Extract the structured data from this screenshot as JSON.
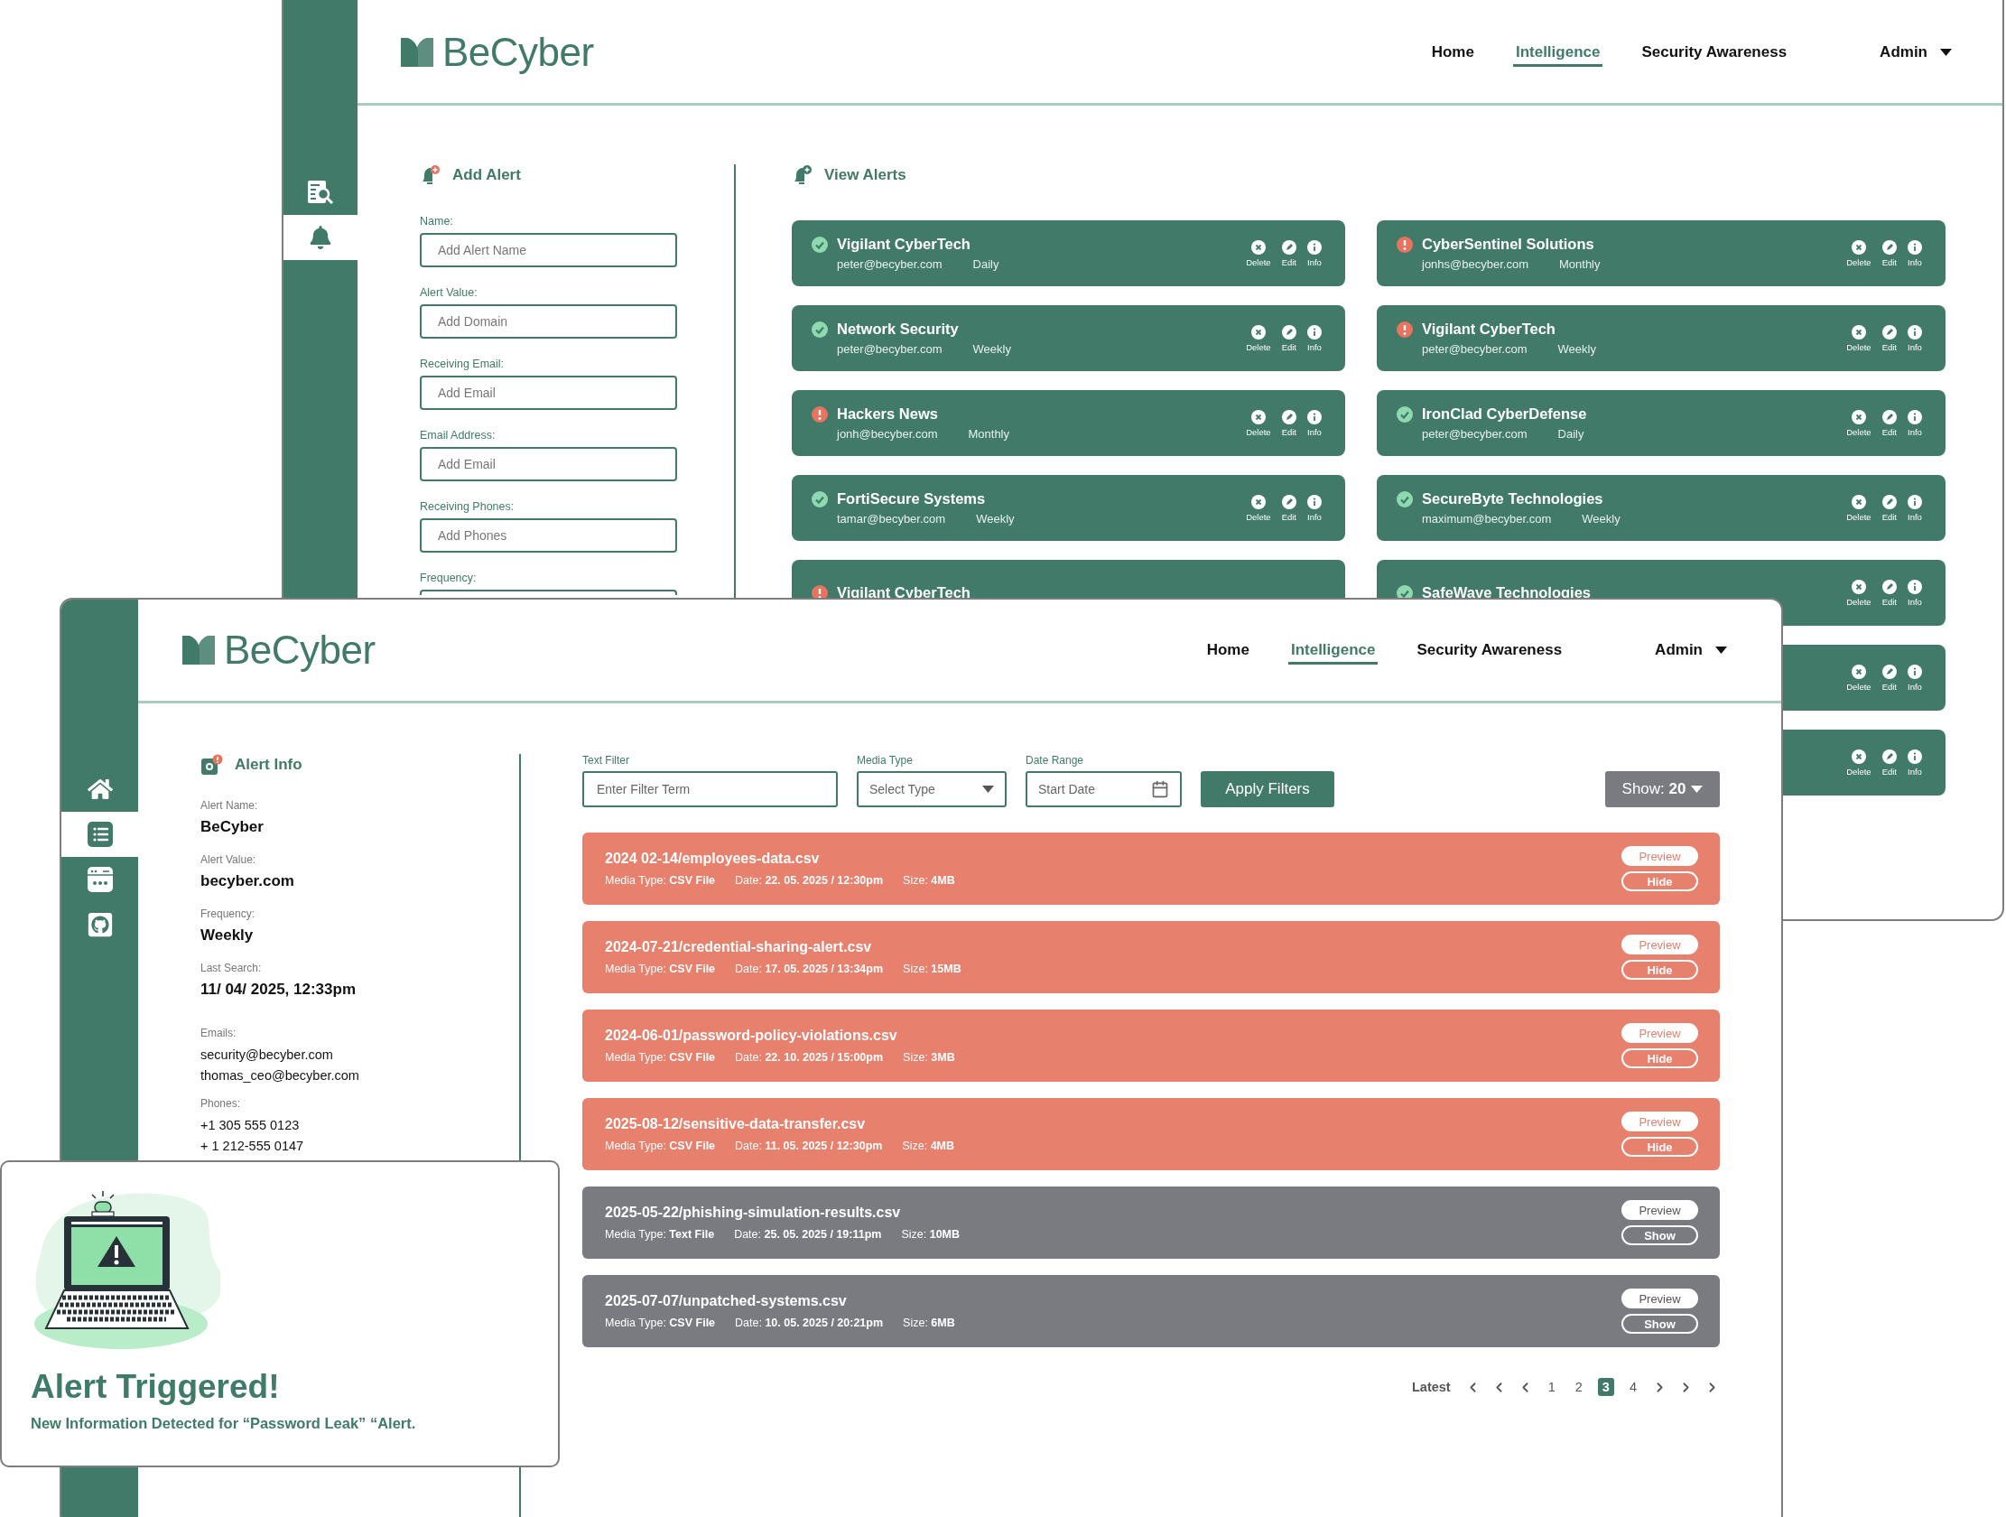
{
  "back_window": {
    "logo": "BeCyber",
    "nav": [
      {
        "label": "Home",
        "selected": false
      },
      {
        "label": "Intelligence",
        "selected": true
      },
      {
        "label": "Security Awareness",
        "selected": false
      }
    ],
    "admin": "Admin",
    "sidebar": [
      {
        "kind": "search",
        "selected": false
      },
      {
        "kind": "bell",
        "selected": true
      }
    ],
    "add_alert": {
      "title": "Add Alert",
      "fields": [
        {
          "label": "Name:",
          "placeholder": "Add Alert Name"
        },
        {
          "label": "Alert Value:",
          "placeholder": "Add Domain"
        },
        {
          "label": "Receiving Email:",
          "placeholder": "Add Email"
        },
        {
          "label": "Email Address:",
          "placeholder": "Add Email"
        },
        {
          "label": "Receiving Phones:",
          "placeholder": "Add Phones"
        },
        {
          "label": "Frequency:"
        }
      ]
    },
    "view_alerts": {
      "title": "View Alerts",
      "columns": [
        {
          "cards": [
            {
              "name": "Vigilant CyberTech",
              "email": "peter@becyber.com",
              "frequency": "Daily",
              "warning": false,
              "actions": [
                "Delete",
                "Edit",
                "Info"
              ]
            },
            {
              "name": "Network Security",
              "email": "peter@becyber.com",
              "frequency": "Weekly",
              "warning": false,
              "actions": [
                "Delete",
                "Edit",
                "Info"
              ]
            },
            {
              "name": "Hackers News",
              "email": "jonh@becyber.com",
              "frequency": "Monthly",
              "warning": true,
              "actions": [
                "Delete",
                "Edit",
                "Info"
              ]
            },
            {
              "name": "FortiSecure Systems",
              "email": "tamar@becyber.com",
              "frequency": "Weekly",
              "warning": false,
              "actions": [
                "Delete",
                "Edit",
                "Info"
              ]
            },
            {
              "name": "Vigilant CyberTech",
              "warning": true
            }
          ]
        },
        {
          "cards": [
            {
              "name": "CyberSentinel Solutions",
              "email": "jonhs@becyber.com",
              "frequency": "Monthly",
              "warning": true,
              "actions": [
                "Delete",
                "Edit",
                "Info"
              ]
            },
            {
              "name": "Vigilant CyberTech",
              "email": "peter@becyber.com",
              "frequency": "Weekly",
              "warning": true,
              "actions": [
                "Delete",
                "Edit",
                "Info"
              ]
            },
            {
              "name": "IronClad CyberDefense",
              "email": "peter@becyber.com",
              "frequency": "Daily",
              "warning": false,
              "actions": [
                "Delete",
                "Edit",
                "Info"
              ]
            },
            {
              "name": "SecureByte Technologies",
              "email": "maximum@becyber.com",
              "frequency": "Weekly",
              "warning": false,
              "actions": [
                "Delete",
                "Edit",
                "Info"
              ]
            },
            {
              "name": "SafeWave Technologies",
              "warning": false,
              "actions": [
                "Delete",
                "Edit",
                "Info"
              ]
            },
            {
              "actions": [
                "Delete",
                "Edit",
                "Info"
              ]
            },
            {
              "actions": [
                "Delete",
                "Edit",
                "Info"
              ]
            }
          ]
        }
      ]
    }
  },
  "front_window": {
    "logo": "BeCyber",
    "nav": [
      {
        "label": "Home",
        "selected": false
      },
      {
        "label": "Intelligence",
        "selected": true
      },
      {
        "label": "Security Awareness",
        "selected": false
      }
    ],
    "admin": "Admin",
    "sidebar": [
      {
        "kind": "home",
        "selected": false
      },
      {
        "kind": "list",
        "selected": true
      },
      {
        "kind": "password",
        "selected": false
      },
      {
        "kind": "github",
        "selected": false
      }
    ],
    "alert_info": {
      "title": "Alert Info",
      "fields": [
        {
          "kind": "summary",
          "label": "Alert Name:",
          "values": [
            "BeCyber"
          ]
        },
        {
          "kind": "summary",
          "label": "Alert Value:",
          "values": [
            "becyber.com"
          ]
        },
        {
          "kind": "summary",
          "label": "Frequency:",
          "values": [
            "Weekly"
          ]
        },
        {
          "kind": "summary",
          "label": "Last Search:",
          "values": [
            "11/ 04/ 2025, 12:33pm"
          ]
        },
        {
          "kind": "list",
          "label": "Emails:",
          "values": [
            "security@becyber.com",
            "thomas_ceo@becyber.com"
          ]
        },
        {
          "kind": "list",
          "label": "Phones:",
          "values": [
            "+1 305 555 0123",
            "+ 1 212-555 0147"
          ]
        }
      ]
    },
    "filters": {
      "text_filter": {
        "label": "Text Filter",
        "placeholder": "Enter Filter Term"
      },
      "media_type": {
        "label": "Media Type",
        "placeholder": "Select Type"
      },
      "date_range": {
        "label": "Date Range",
        "placeholder": "Start Date"
      },
      "apply": "Apply Filters",
      "show": "Show: **20**"
    },
    "files": [
      {
        "name": "2024 02-14/employees-data.csv",
        "meta": [
          "Media Type: **CSV File**",
          "Date: **22. 05. 2025 / 12:30pm**",
          "Size: **4MB**"
        ],
        "highlighted": true,
        "buttons": [
          "Preview",
          "Hide"
        ]
      },
      {
        "name": "2024-07-21/credential-sharing-alert.csv",
        "meta": [
          "Media Type: **CSV File**",
          "Date: **17. 05. 2025 / 13:34pm**",
          "Size: **15MB**"
        ],
        "highlighted": true,
        "buttons": [
          "Preview",
          "Hide"
        ]
      },
      {
        "name": "2024-06-01/password-policy-violations.csv",
        "meta": [
          "Media Type: **CSV File**",
          "Date: **22. 10. 2025 / 15:00pm**",
          "Size: **3MB**"
        ],
        "highlighted": true,
        "buttons": [
          "Preview",
          "Hide"
        ]
      },
      {
        "name": "2025-08-12/sensitive-data-transfer.csv",
        "meta": [
          "Media Type: **CSV File**",
          "Date: **11. 05. 2025 / 12:30pm**",
          "Size: **4MB**"
        ],
        "highlighted": true,
        "buttons": [
          "Preview",
          "Hide"
        ]
      },
      {
        "name": "2025-05-22/phishing-simulation-results.csv",
        "meta": [
          "Media Type: **Text File**",
          "Date: **25. 05. 2025 / 19:11pm**",
          "Size: **10MB**"
        ],
        "highlighted": false,
        "buttons": [
          "Preview",
          "Show"
        ]
      },
      {
        "name": "2025-07-07/unpatched-systems.csv",
        "meta": [
          "Media Type: **CSV File**",
          "Date: **10. 05. 2025 / 20:21pm**",
          "Size: **6MB**"
        ],
        "highlighted": false,
        "buttons": [
          "Preview",
          "Show"
        ]
      }
    ],
    "pagination": {
      "first": "Latest",
      "pages": [
        {
          "label": "1",
          "selected": false
        },
        {
          "label": "2",
          "selected": false
        },
        {
          "label": "3",
          "selected": true
        },
        {
          "label": "4",
          "selected": false
        }
      ]
    }
  },
  "alert_popup": {
    "title": "Alert Triggered!",
    "message": "New Information Detected for “Password Leak” “Alert."
  }
}
